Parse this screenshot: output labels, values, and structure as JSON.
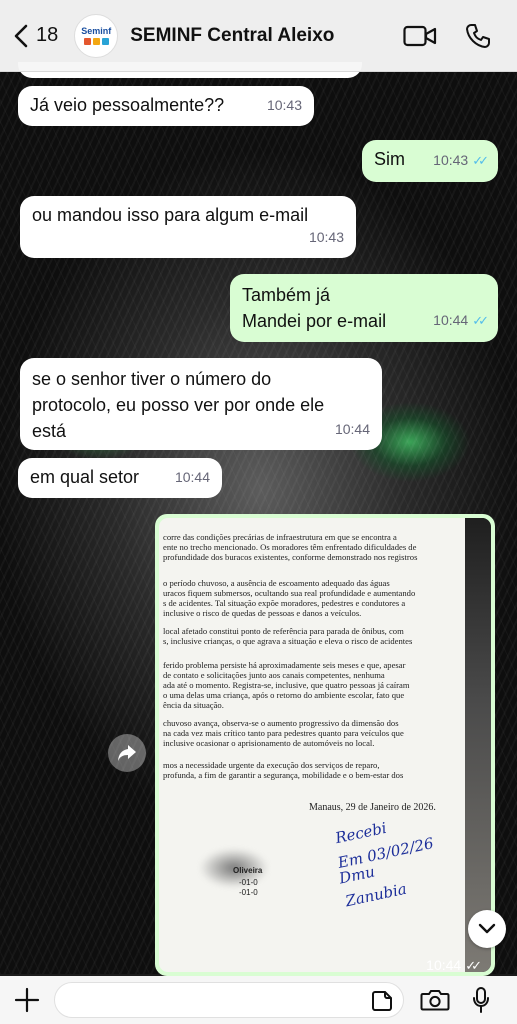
{
  "header": {
    "back_count": "18",
    "avatar_brand": "Seminf",
    "title": "SEMINF  Central Aleixo"
  },
  "messages": [
    {
      "text": "Já veio pessoalmente??",
      "time": "10:43",
      "dir": "in"
    },
    {
      "text": "Sim",
      "time": "10:43",
      "dir": "out"
    },
    {
      "text": "ou mandou isso para algum e-mail",
      "time": "10:43",
      "dir": "in"
    },
    {
      "text_line1": "Também já",
      "text_line2": "Mandei por e-mail",
      "time": "10:44",
      "dir": "out"
    },
    {
      "text_line1": "se o senhor tiver o número do",
      "text_line2": "protocolo, eu posso ver por onde ele",
      "text_line3": "está",
      "time": "10:44",
      "dir": "in"
    },
    {
      "text": "em qual setor",
      "time": "10:44",
      "dir": "in"
    }
  ],
  "image_message": {
    "time": "10:44",
    "paragraphs": [
      "corre das condições precárias de infraestrutura em que se encontra a\nente no trecho mencionado. Os moradores têm enfrentado dificuldades de\nprofundidade dos buracos existentes, conforme demonstrado nos registros",
      "o período chuvoso, a ausência de escoamento adequado das águas\nuracos fiquem submersos, ocultando sua real profundidade e aumentando\ns de acidentes. Tal situação expõe moradores, pedestres e condutores a\ninclusive o risco de quedas de pessoas e danos a veículos.",
      "local afetado constitui ponto de referência para parada de ônibus, com\ns, inclusive crianças, o que agrava a situação e eleva o risco de acidentes",
      "ferido problema persiste há aproximadamente seis meses e que, apesar\nde contato e solicitações junto aos canais competentes, nenhuma\nada até o momento. Registra-se, inclusive, que quatro pessoas já caíram\no uma delas uma criança, após o retorno do ambiente escolar, fato que\nência da situação.",
      "chuvoso avança, observa-se o aumento progressivo da dimensão dos\nna cada vez mais crítico tanto para pedestres quanto para veículos que\ninclusive ocasionar o aprisionamento de automóveis no local.",
      "mos a necessidade urgente da execução dos serviços de reparo,\nprofunda, a fim de garantir a segurança, mobilidade e o bem-estar dos"
    ],
    "date_line": "Manaus, 29 de Janeiro de 2026.",
    "signature_name": "Oliveira",
    "footer_lines": "-01-0\n-01-0",
    "handwriting_1": "Recebi",
    "handwriting_2": "Em 03/02/26",
    "handwriting_3": "Dmu",
    "handwriting_4": "Zanubia"
  }
}
